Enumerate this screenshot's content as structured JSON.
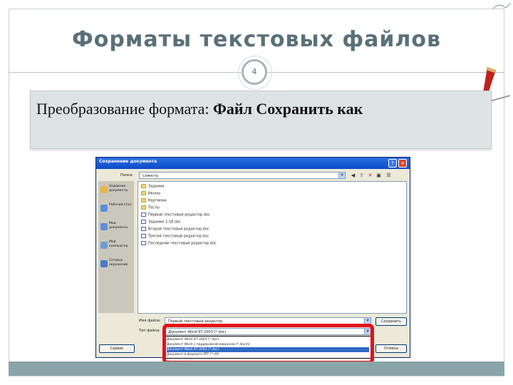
{
  "slide": {
    "title": "Форматы текстовых файлов",
    "page_number": "4",
    "content_prefix": "Преобразование формата: ",
    "content_menu": "Файл",
    "content_arrow": "",
    "content_item": "Сохранить как"
  },
  "dialog": {
    "title": "Сохранение документа",
    "help_label": "?",
    "close_label": "×",
    "folder_label": "Папка:",
    "folder_value": "Семестр",
    "toolbar_icons": [
      "back-icon",
      "up-folder-icon",
      "delete-icon",
      "new-folder-icon",
      "views-icon"
    ],
    "places": [
      {
        "label": "Недавние документы",
        "icon": "recent-icon"
      },
      {
        "label": "Рабочий стол",
        "icon": "desktop-icon"
      },
      {
        "label": "Мои документы",
        "icon": "my-documents-icon"
      },
      {
        "label": "Мой компьютер",
        "icon": "my-computer-icon"
      },
      {
        "label": "Сетевое окружение",
        "icon": "network-icon"
      }
    ],
    "files": [
      {
        "name": "Задания",
        "type": "folder"
      },
      {
        "name": "Иконы",
        "type": "folder"
      },
      {
        "name": "Картинки",
        "type": "folder"
      },
      {
        "name": "Тесты",
        "type": "folder"
      },
      {
        "name": "Первый текстовый редактор.doc",
        "type": "doc"
      },
      {
        "name": "Задание 1-18.doc",
        "type": "doc"
      },
      {
        "name": "Второй текстовый редактор.doc",
        "type": "doc"
      },
      {
        "name": "Третий текстовый редактор.doc",
        "type": "doc"
      },
      {
        "name": "Последний текстовый редактор.doc",
        "type": "doc"
      }
    ],
    "filename_label": "Имя файла:",
    "filename_value": "Первый текстовый редактор",
    "filetype_label": "Тип файла:",
    "filetype_value": "Документ Word 97-2003 (*.doc)",
    "filetype_options": [
      {
        "label": "Документ Word 97-2003 (*.doc)",
        "selected": false
      },
      {
        "label": "Документ Word с поддержкой макросов (*.docm)",
        "selected": false
      },
      {
        "label": "Документ Word 97-2003 (*.doc)",
        "selected": true
      },
      {
        "label": "Документ в формате RTF (*.rtf)",
        "selected": false
      }
    ],
    "service_button": "Сервис",
    "save_button": "Сохранить",
    "cancel_button": "Отмена"
  },
  "colors": {
    "title": "#5a7078",
    "accent_bar": "#8aa5a9",
    "highlight": "#e3101a",
    "titlebar": "#0b4bc9"
  }
}
